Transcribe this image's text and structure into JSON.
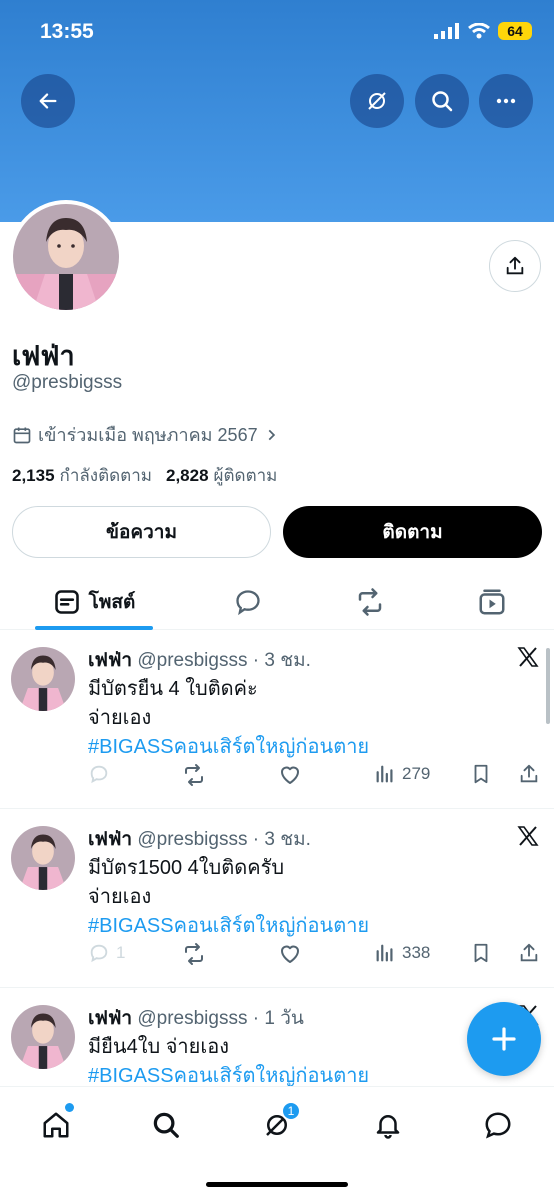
{
  "status_bar": {
    "time": "13:55",
    "battery": "64"
  },
  "profile": {
    "display_name": "เฟฟ่า",
    "handle": "@presbigsss",
    "joined": "เข้าร่วมเมือ พฤษภาคม 2567",
    "following_count": "2,135",
    "following_label": "กำลังติดตาม",
    "followers_count": "2,828",
    "followers_label": "ผู้ติดตาม"
  },
  "buttons": {
    "message": "ข้อความ",
    "follow": "ติดตาม"
  },
  "tabs": {
    "posts": "โพสต์"
  },
  "posts": [
    {
      "name": "เฟฟ่า",
      "handle": "@presbigsss",
      "time": "· 3 ชม.",
      "line1": "มีบัตรยืน 4 ใบติดค่ะ",
      "line2": "จ่ายเอง",
      "hashtag": "#BIGASSคอนเสิร์ตใหญ่ก่อนตาย",
      "replies": "",
      "views": "279"
    },
    {
      "name": "เฟฟ่า",
      "handle": "@presbigsss",
      "time": "· 3 ชม.",
      "line1": "มีบัตร1500 4ใบติดครับ",
      "line2": "จ่ายเอง",
      "hashtag": "#BIGASSคอนเสิร์ตใหญ่ก่อนตาย",
      "replies": "1",
      "views": "338"
    },
    {
      "name": "เฟฟ่า",
      "handle": "@presbigsss",
      "time": "· 1 วัน",
      "line1": "มียืน4ใบ จ่ายเอง",
      "hashtag": "#BIGASSคอนเสิร์ตใหญ่ก่อนตาย"
    }
  ],
  "nav": {
    "communities_badge": "1"
  },
  "colors": {
    "accent": "#1d9bf0",
    "banner": "#3a8ede",
    "text": "#0f1419",
    "muted": "#536471"
  },
  "icons": [
    "back-arrow-icon",
    "grok-icon",
    "search-icon",
    "more-icon",
    "share-icon",
    "calendar-icon",
    "chevron-right-icon",
    "posts-tab-icon",
    "replies-tab-icon",
    "reposts-tab-icon",
    "media-tab-icon",
    "x-logo-icon",
    "reply-icon",
    "repost-icon",
    "like-icon",
    "views-icon",
    "bookmark-icon",
    "compose-plus-icon",
    "home-icon",
    "communities-icon",
    "bell-icon",
    "messages-icon"
  ]
}
